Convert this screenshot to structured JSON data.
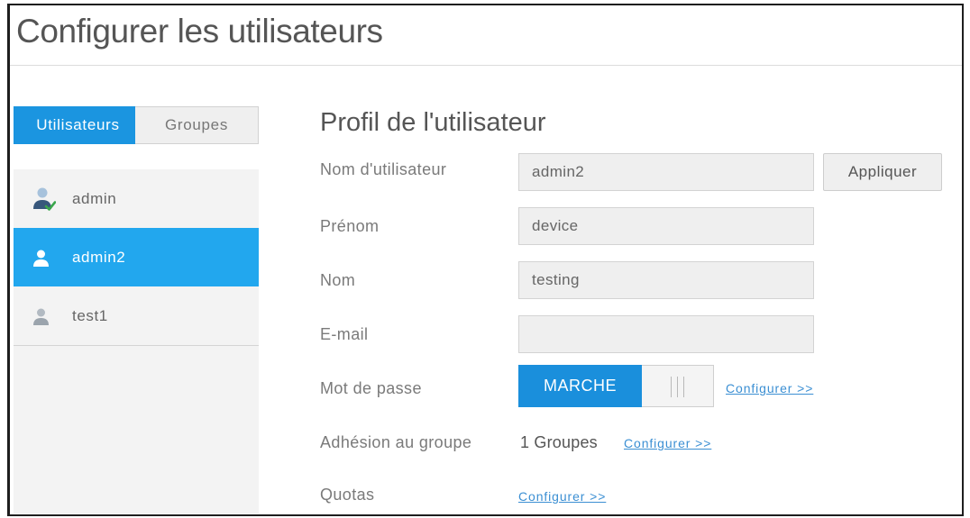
{
  "page": {
    "title": "Configurer les utilisateurs"
  },
  "tabs": [
    {
      "label": "Utilisateurs",
      "active": true
    },
    {
      "label": "Groupes",
      "active": false
    }
  ],
  "users": [
    {
      "name": "admin",
      "icon": "admin-user-icon",
      "selected": false
    },
    {
      "name": "admin2",
      "icon": "user-icon",
      "selected": true
    },
    {
      "name": "test1",
      "icon": "user-icon",
      "selected": false
    }
  ],
  "profile": {
    "heading": "Profil de l'utilisateur",
    "username": {
      "label": "Nom d'utilisateur",
      "value": "admin2"
    },
    "apply_button": "Appliquer",
    "first_name": {
      "label": "Prénom",
      "value": "device"
    },
    "last_name": {
      "label": "Nom",
      "value": "testing"
    },
    "email": {
      "label": "E-mail",
      "value": ""
    },
    "password": {
      "label": "Mot de passe",
      "toggle_label": "MARCHE",
      "toggle_on": true,
      "toggle_icon": "toggle-grip-icon",
      "link": "Configurer >>"
    },
    "group_membership": {
      "label": "Adhésion au groupe",
      "value": "1 Groupes",
      "link": "Configurer >>"
    },
    "quotas": {
      "label": "Quotas",
      "link": "Configurer >>"
    }
  },
  "colors": {
    "accent": "#1b95e0",
    "selected_row": "#22a7ee",
    "toggle_on": "#1a8fdc",
    "link": "#3b8fd3",
    "admin_check": "#3aa64c"
  }
}
